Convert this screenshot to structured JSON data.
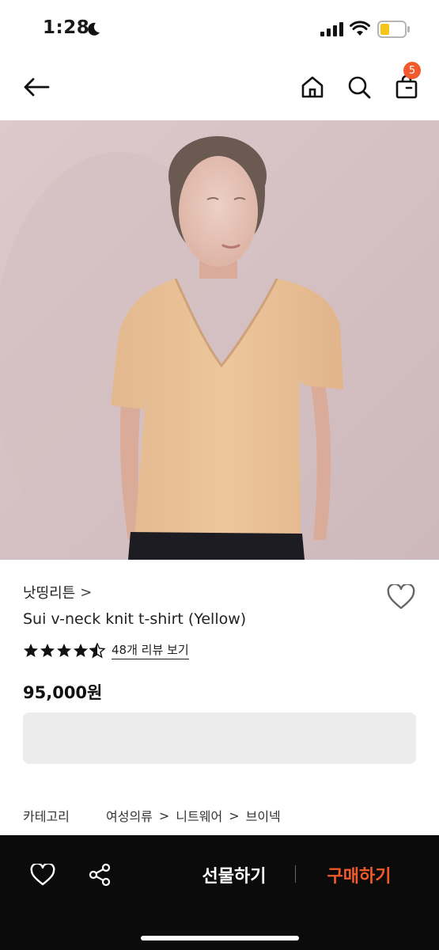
{
  "status_bar": {
    "time": "1:28",
    "icons": [
      "moon-icon",
      "signal-icon",
      "wifi-icon",
      "battery-icon"
    ]
  },
  "nav": {
    "icons": [
      "back-arrow-icon",
      "home-icon",
      "search-icon",
      "shopping-bag-icon"
    ],
    "cart_count": "5"
  },
  "product": {
    "brand": "낫띵리튼",
    "brand_chevron": ">",
    "name": "Sui v-neck knit t-shirt (Yellow)",
    "rating": 4.5,
    "review_link": "48개 리뷰 보기",
    "price": "95,000원"
  },
  "category": {
    "label": "카테고리",
    "path": [
      "여성의류",
      "니트웨어",
      "브이넥"
    ],
    "separator": ">"
  },
  "bottom_bar": {
    "gift_label": "선물하기",
    "buy_label": "구매하기",
    "icons": [
      "heart-icon",
      "share-icon"
    ]
  },
  "colors": {
    "accent": "#f25a2c",
    "bottom_bar_bg": "#0b0b0b",
    "placeholder_box": "#ececec"
  }
}
